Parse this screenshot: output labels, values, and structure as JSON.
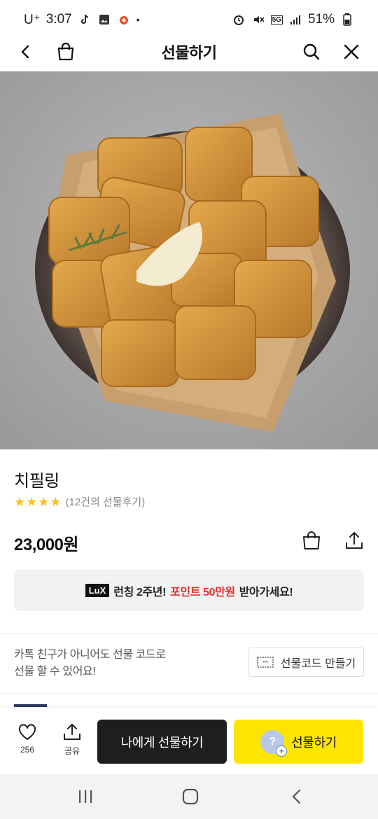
{
  "status_bar": {
    "carrier": "U⁺",
    "time": "3:07",
    "network": "5G",
    "battery": "51%"
  },
  "header": {
    "title": "선물하기"
  },
  "product": {
    "name": "치필링",
    "rating_stars": 4,
    "rating_text": "(12건의 선물후기)",
    "price": "23,000원"
  },
  "promo": {
    "badge": "LuX",
    "text_before": "런칭 2주년!",
    "text_highlight": "포인트 50만원",
    "text_after": "받아가세요!"
  },
  "gift_code": {
    "line1": "카톡 친구가 아니어도 선물 코드로",
    "line2": "선물 할 수 있어요!",
    "button_label": "선물코드 만들기"
  },
  "action_bar": {
    "like_count": "256",
    "share_label": "공유",
    "gift_self_label": "나에게 선물하기",
    "gift_label": "선물하기",
    "gift_avatar_glyph": "?"
  },
  "colors": {
    "brand_yellow": "#fee500",
    "dark_button": "#1e1e1e",
    "promo_red": "#e83030",
    "star": "#f5c518"
  },
  "icons": [
    "back-icon",
    "shopping-bag-icon",
    "search-icon",
    "close-icon",
    "heart-icon",
    "share-icon",
    "cart-icon",
    "code-ticket-icon",
    "recent-apps-icon",
    "home-icon",
    "nav-back-icon"
  ]
}
